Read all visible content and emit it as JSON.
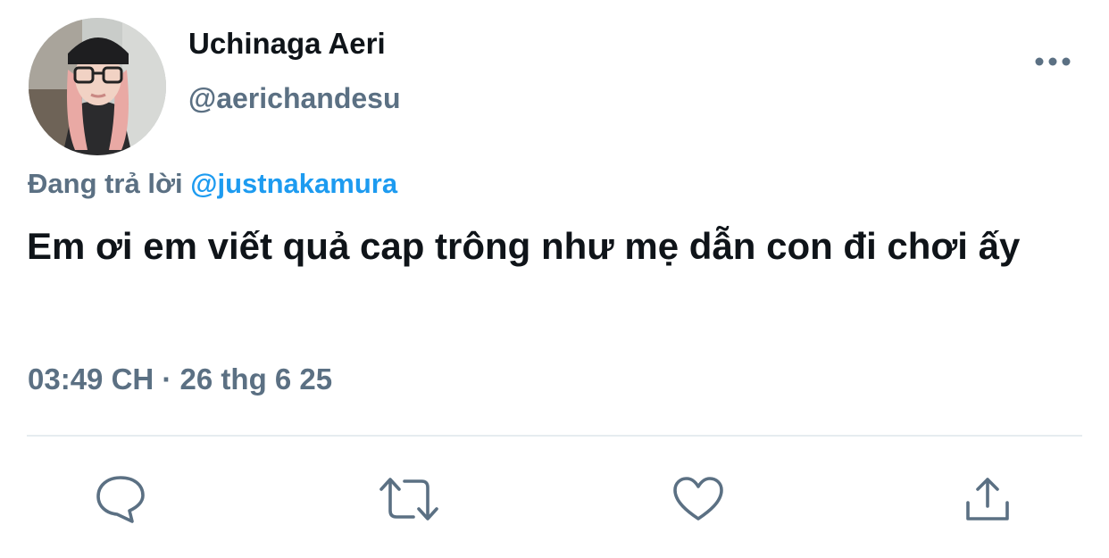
{
  "tweet": {
    "display_name": "Uchinaga Aeri",
    "handle": "@aerichandesu",
    "reply_prefix": "Đang trả lời",
    "reply_to": "@justnakamura",
    "text": "Em ơi em viết quả cap trông như mẹ dẫn con đi chơi ấy",
    "timestamp": "03:49 CH · 26 thg 6 25"
  },
  "icons": {
    "more": "more-horizontal-icon",
    "reply": "reply-bubble-icon",
    "retweet": "retweet-icon",
    "like": "heart-icon",
    "share": "share-upload-icon"
  },
  "colors": {
    "text_primary": "#0f1419",
    "text_secondary": "#5b7083",
    "mention": "#1d9bf0",
    "icon": "#5b7083",
    "divider": "#e6ecf0"
  }
}
